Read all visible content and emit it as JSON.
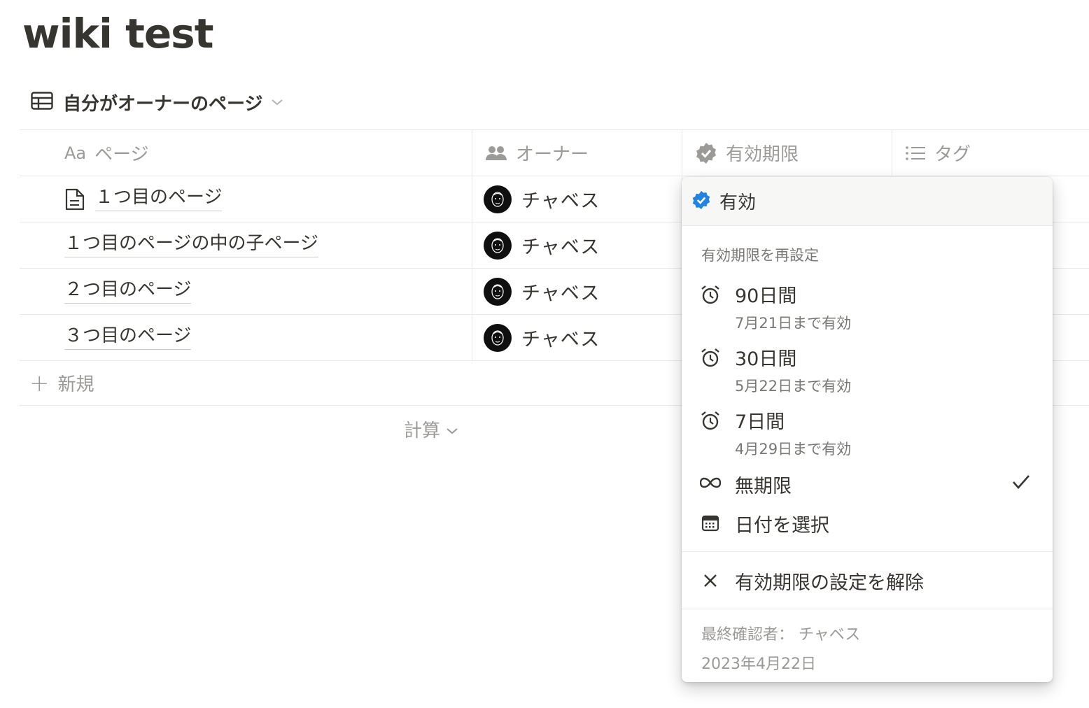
{
  "page": {
    "title": "wiki test"
  },
  "view": {
    "label": "自分がオーナーのページ"
  },
  "table": {
    "headers": {
      "page": "ページ",
      "page_prefix": "Aa",
      "owner": "オーナー",
      "verification": "有効期限",
      "tags": "タグ"
    },
    "rows": [
      {
        "name": "１つ目のページ",
        "owner": "チャベス",
        "has_doc_icon": true
      },
      {
        "name": "１つ目のページの中の子ページ",
        "owner": "チャベス",
        "has_doc_icon": false
      },
      {
        "name": "２つ目のページ",
        "owner": "チャベス",
        "has_doc_icon": false
      },
      {
        "name": "３つ目のページ",
        "owner": "チャベス",
        "has_doc_icon": false
      }
    ],
    "new_label": "新規",
    "calc_label": "計算"
  },
  "popup": {
    "status": "有効",
    "section_label": "有効期限を再設定",
    "options": [
      {
        "label": "90日間",
        "sub": "7月21日まで有効",
        "icon": "alarm-clock-icon"
      },
      {
        "label": "30日間",
        "sub": "5月22日まで有効",
        "icon": "alarm-clock-icon"
      },
      {
        "label": "7日間",
        "sub": "4月29日まで有効",
        "icon": "alarm-clock-icon"
      },
      {
        "label": "無期限",
        "icon": "infinity-icon",
        "selected": true
      },
      {
        "label": "日付を選択",
        "icon": "calendar-icon"
      }
    ],
    "remove_label": "有効期限の設定を解除",
    "last_verified_by": "最終確認者： チャベス",
    "last_verified_date": "2023年4月22日"
  },
  "colors": {
    "text": "#37352f",
    "muted": "#9b9a97",
    "border": "#e9e9e7",
    "verified": "#2383e2"
  }
}
